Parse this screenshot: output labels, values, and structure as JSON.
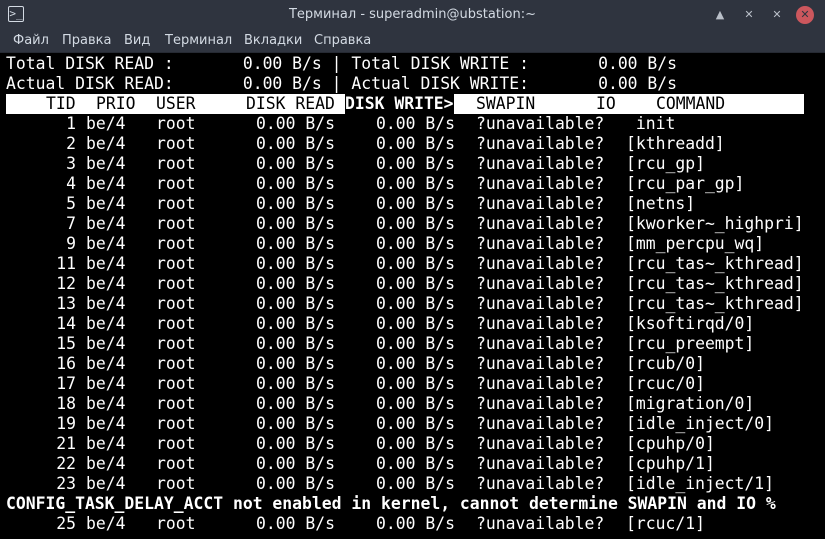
{
  "window": {
    "title": "Терминал - superadmin@ubstation:~",
    "app_icon": ">_",
    "buttons": {
      "shade": "▲",
      "minimize": "✕",
      "maximize": "✕",
      "close": "✕"
    }
  },
  "menu": [
    "Файл",
    "Правка",
    "Вид",
    "Терминал",
    "Вкладки",
    "Справка"
  ],
  "summary": {
    "line1": "Total DISK READ :       0.00 B/s | Total DISK WRITE :       0.00 B/s",
    "line2": "Actual DISK READ:       0.00 B/s | Actual DISK WRITE:       0.00 B/s"
  },
  "columns": {
    "tid": "TID",
    "prio": "PRIO",
    "user": "USER",
    "disk_read": "DISK READ",
    "disk_write": "DISK WRITE>",
    "swapin": "SWAPIN",
    "io": "IO",
    "command": "COMMAND"
  },
  "rows": [
    {
      "tid": "1",
      "prio": "be/4",
      "user": "root",
      "disk_read": "0.00 B/s",
      "disk_write": "0.00 B/s",
      "swapin": "?unavailable?",
      "command": " init"
    },
    {
      "tid": "2",
      "prio": "be/4",
      "user": "root",
      "disk_read": "0.00 B/s",
      "disk_write": "0.00 B/s",
      "swapin": "?unavailable?",
      "command": "[kthreadd]"
    },
    {
      "tid": "3",
      "prio": "be/4",
      "user": "root",
      "disk_read": "0.00 B/s",
      "disk_write": "0.00 B/s",
      "swapin": "?unavailable?",
      "command": "[rcu_gp]"
    },
    {
      "tid": "4",
      "prio": "be/4",
      "user": "root",
      "disk_read": "0.00 B/s",
      "disk_write": "0.00 B/s",
      "swapin": "?unavailable?",
      "command": "[rcu_par_gp]"
    },
    {
      "tid": "5",
      "prio": "be/4",
      "user": "root",
      "disk_read": "0.00 B/s",
      "disk_write": "0.00 B/s",
      "swapin": "?unavailable?",
      "command": "[netns]"
    },
    {
      "tid": "7",
      "prio": "be/4",
      "user": "root",
      "disk_read": "0.00 B/s",
      "disk_write": "0.00 B/s",
      "swapin": "?unavailable?",
      "command": "[kworker~_highpri]"
    },
    {
      "tid": "9",
      "prio": "be/4",
      "user": "root",
      "disk_read": "0.00 B/s",
      "disk_write": "0.00 B/s",
      "swapin": "?unavailable?",
      "command": "[mm_percpu_wq]"
    },
    {
      "tid": "11",
      "prio": "be/4",
      "user": "root",
      "disk_read": "0.00 B/s",
      "disk_write": "0.00 B/s",
      "swapin": "?unavailable?",
      "command": "[rcu_tas~_kthread]"
    },
    {
      "tid": "12",
      "prio": "be/4",
      "user": "root",
      "disk_read": "0.00 B/s",
      "disk_write": "0.00 B/s",
      "swapin": "?unavailable?",
      "command": "[rcu_tas~_kthread]"
    },
    {
      "tid": "13",
      "prio": "be/4",
      "user": "root",
      "disk_read": "0.00 B/s",
      "disk_write": "0.00 B/s",
      "swapin": "?unavailable?",
      "command": "[rcu_tas~_kthread]"
    },
    {
      "tid": "14",
      "prio": "be/4",
      "user": "root",
      "disk_read": "0.00 B/s",
      "disk_write": "0.00 B/s",
      "swapin": "?unavailable?",
      "command": "[ksoftirqd/0]"
    },
    {
      "tid": "15",
      "prio": "be/4",
      "user": "root",
      "disk_read": "0.00 B/s",
      "disk_write": "0.00 B/s",
      "swapin": "?unavailable?",
      "command": "[rcu_preempt]"
    },
    {
      "tid": "16",
      "prio": "be/4",
      "user": "root",
      "disk_read": "0.00 B/s",
      "disk_write": "0.00 B/s",
      "swapin": "?unavailable?",
      "command": "[rcub/0]"
    },
    {
      "tid": "17",
      "prio": "be/4",
      "user": "root",
      "disk_read": "0.00 B/s",
      "disk_write": "0.00 B/s",
      "swapin": "?unavailable?",
      "command": "[rcuc/0]"
    },
    {
      "tid": "18",
      "prio": "be/4",
      "user": "root",
      "disk_read": "0.00 B/s",
      "disk_write": "0.00 B/s",
      "swapin": "?unavailable?",
      "command": "[migration/0]"
    },
    {
      "tid": "19",
      "prio": "be/4",
      "user": "root",
      "disk_read": "0.00 B/s",
      "disk_write": "0.00 B/s",
      "swapin": "?unavailable?",
      "command": "[idle_inject/0]"
    },
    {
      "tid": "21",
      "prio": "be/4",
      "user": "root",
      "disk_read": "0.00 B/s",
      "disk_write": "0.00 B/s",
      "swapin": "?unavailable?",
      "command": "[cpuhp/0]"
    },
    {
      "tid": "22",
      "prio": "be/4",
      "user": "root",
      "disk_read": "0.00 B/s",
      "disk_write": "0.00 B/s",
      "swapin": "?unavailable?",
      "command": "[cpuhp/1]"
    },
    {
      "tid": "23",
      "prio": "be/4",
      "user": "root",
      "disk_read": "0.00 B/s",
      "disk_write": "0.00 B/s",
      "swapin": "?unavailable?",
      "command": "[idle_inject/1]"
    }
  ],
  "warning": "CONFIG_TASK_DELAY_ACCT not enabled in kernel, cannot determine SWAPIN and IO %",
  "last_row": {
    "tid": "25",
    "prio": "be/4",
    "user": "root",
    "disk_read": "0.00 B/s",
    "disk_write": "0.00 B/s",
    "swapin": "?unavailable?",
    "command": "[rcuc/1]"
  }
}
